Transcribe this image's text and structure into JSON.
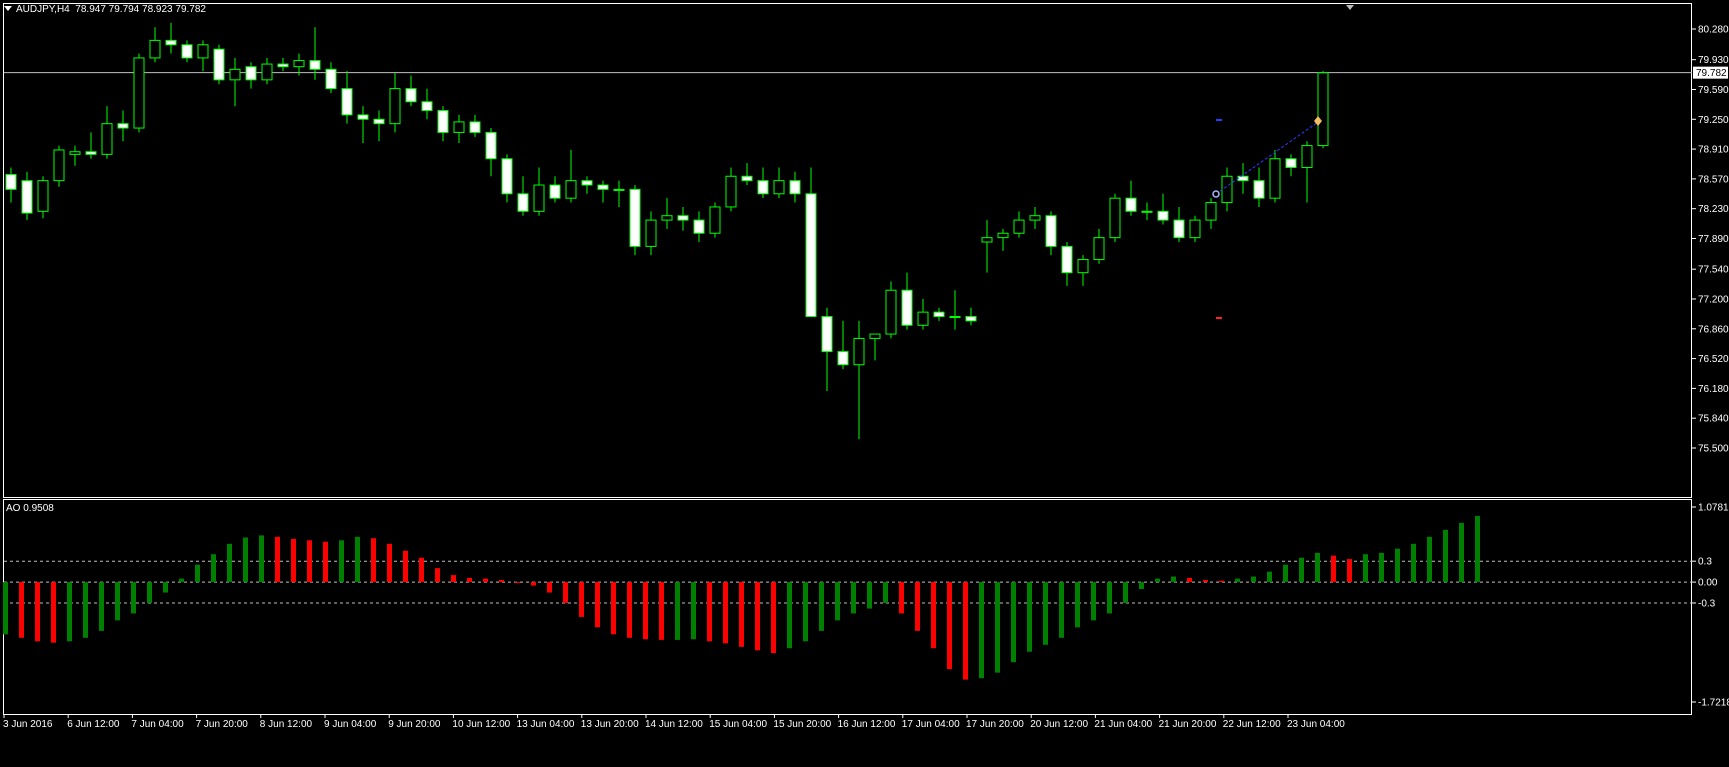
{
  "window": {
    "symbol_label": "AUDJPY,H4",
    "ohlc_label": "78.947 79.794 78.923 79.782"
  },
  "colors": {
    "background": "#000000",
    "grid": "#ffffff",
    "bull_candle_body": "#000000",
    "bull_candle_border": "#00ff00",
    "bear_candle_body": "#ffffff",
    "bear_candle_border": "#00ff00",
    "ao_up": "#008000",
    "ao_down": "#ff0000"
  },
  "price_axis": {
    "ticks": [
      "80.280",
      "79.930",
      "79.590",
      "79.250",
      "78.910",
      "78.570",
      "78.230",
      "77.890",
      "77.540",
      "77.200",
      "76.860",
      "76.520",
      "76.180",
      "75.840",
      "75.500"
    ],
    "current_price_label": "79.782"
  },
  "ao_panel": {
    "title": "AO 0.9508",
    "ticks": [
      "1.0781",
      "0.3",
      "0.00",
      "-0.3",
      "-1.7218"
    ]
  },
  "time_axis": {
    "labels": [
      "3 Jun 2016",
      "6 Jun 12:00",
      "7 Jun 04:00",
      "7 Jun 20:00",
      "8 Jun 12:00",
      "9 Jun 04:00",
      "9 Jun 20:00",
      "10 Jun 12:00",
      "13 Jun 04:00",
      "13 Jun 20:00",
      "14 Jun 12:00",
      "15 Jun 04:00",
      "15 Jun 20:00",
      "16 Jun 12:00",
      "17 Jun 04:00",
      "17 Jun 20:00",
      "20 Jun 12:00",
      "21 Jun 04:00",
      "21 Jun 20:00",
      "22 Jun 12:00",
      "23 Jun 04:00"
    ]
  },
  "chart_data": [
    {
      "type": "candlestick",
      "title": "AUDJPY,H4",
      "ylim": [
        75.5,
        80.28
      ],
      "current_price": 79.782,
      "candles": [
        {
          "o": 78.62,
          "h": 78.7,
          "l": 78.3,
          "c": 78.45
        },
        {
          "o": 78.55,
          "h": 78.65,
          "l": 78.1,
          "c": 78.18
        },
        {
          "o": 78.2,
          "h": 78.6,
          "l": 78.12,
          "c": 78.55
        },
        {
          "o": 78.55,
          "h": 78.95,
          "l": 78.48,
          "c": 78.9
        },
        {
          "o": 78.85,
          "h": 78.95,
          "l": 78.72,
          "c": 78.88
        },
        {
          "o": 78.88,
          "h": 79.1,
          "l": 78.8,
          "c": 78.85
        },
        {
          "o": 78.85,
          "h": 79.4,
          "l": 78.8,
          "c": 79.2
        },
        {
          "o": 79.2,
          "h": 79.35,
          "l": 79.0,
          "c": 79.15
        },
        {
          "o": 79.15,
          "h": 80.0,
          "l": 79.1,
          "c": 79.95
        },
        {
          "o": 79.95,
          "h": 80.3,
          "l": 79.9,
          "c": 80.15
        },
        {
          "o": 80.15,
          "h": 80.35,
          "l": 80.0,
          "c": 80.1
        },
        {
          "o": 80.1,
          "h": 80.15,
          "l": 79.9,
          "c": 79.95
        },
        {
          "o": 79.95,
          "h": 80.15,
          "l": 79.8,
          "c": 80.1
        },
        {
          "o": 80.05,
          "h": 80.1,
          "l": 79.65,
          "c": 79.7
        },
        {
          "o": 79.7,
          "h": 79.95,
          "l": 79.4,
          "c": 79.82
        },
        {
          "o": 79.85,
          "h": 79.9,
          "l": 79.6,
          "c": 79.7
        },
        {
          "o": 79.7,
          "h": 79.95,
          "l": 79.65,
          "c": 79.88
        },
        {
          "o": 79.88,
          "h": 79.95,
          "l": 79.8,
          "c": 79.85
        },
        {
          "o": 79.85,
          "h": 80.0,
          "l": 79.75,
          "c": 79.92
        },
        {
          "o": 79.92,
          "h": 80.3,
          "l": 79.7,
          "c": 79.82
        },
        {
          "o": 79.82,
          "h": 79.9,
          "l": 79.55,
          "c": 79.6
        },
        {
          "o": 79.6,
          "h": 79.8,
          "l": 79.2,
          "c": 79.3
        },
        {
          "o": 79.3,
          "h": 79.4,
          "l": 78.98,
          "c": 79.25
        },
        {
          "o": 79.25,
          "h": 79.35,
          "l": 79.0,
          "c": 79.2
        },
        {
          "o": 79.2,
          "h": 79.78,
          "l": 79.1,
          "c": 79.6
        },
        {
          "o": 79.6,
          "h": 79.75,
          "l": 79.4,
          "c": 79.45
        },
        {
          "o": 79.45,
          "h": 79.6,
          "l": 79.25,
          "c": 79.35
        },
        {
          "o": 79.35,
          "h": 79.4,
          "l": 79.0,
          "c": 79.1
        },
        {
          "o": 79.1,
          "h": 79.3,
          "l": 78.98,
          "c": 79.22
        },
        {
          "o": 79.22,
          "h": 79.3,
          "l": 79.05,
          "c": 79.1
        },
        {
          "o": 79.1,
          "h": 79.15,
          "l": 78.6,
          "c": 78.8
        },
        {
          "o": 78.8,
          "h": 78.85,
          "l": 78.3,
          "c": 78.4
        },
        {
          "o": 78.4,
          "h": 78.6,
          "l": 78.15,
          "c": 78.2
        },
        {
          "o": 78.2,
          "h": 78.7,
          "l": 78.15,
          "c": 78.5
        },
        {
          "o": 78.5,
          "h": 78.6,
          "l": 78.3,
          "c": 78.35
        },
        {
          "o": 78.35,
          "h": 78.9,
          "l": 78.3,
          "c": 78.55
        },
        {
          "o": 78.55,
          "h": 78.6,
          "l": 78.4,
          "c": 78.5
        },
        {
          "o": 78.5,
          "h": 78.55,
          "l": 78.3,
          "c": 78.45
        },
        {
          "o": 78.45,
          "h": 78.55,
          "l": 78.25,
          "c": 78.45
        },
        {
          "o": 78.45,
          "h": 78.5,
          "l": 77.7,
          "c": 77.8
        },
        {
          "o": 77.8,
          "h": 78.2,
          "l": 77.7,
          "c": 78.1
        },
        {
          "o": 78.1,
          "h": 78.35,
          "l": 78.0,
          "c": 78.15
        },
        {
          "o": 78.15,
          "h": 78.25,
          "l": 77.98,
          "c": 78.1
        },
        {
          "o": 78.1,
          "h": 78.2,
          "l": 77.85,
          "c": 77.95
        },
        {
          "o": 77.95,
          "h": 78.3,
          "l": 77.9,
          "c": 78.25
        },
        {
          "o": 78.25,
          "h": 78.7,
          "l": 78.2,
          "c": 78.6
        },
        {
          "o": 78.6,
          "h": 78.75,
          "l": 78.5,
          "c": 78.55
        },
        {
          "o": 78.55,
          "h": 78.7,
          "l": 78.35,
          "c": 78.4
        },
        {
          "o": 78.4,
          "h": 78.7,
          "l": 78.35,
          "c": 78.55
        },
        {
          "o": 78.55,
          "h": 78.65,
          "l": 78.3,
          "c": 78.4
        },
        {
          "o": 78.4,
          "h": 78.7,
          "l": 77.0,
          "c": 77.0
        },
        {
          "o": 77.0,
          "h": 77.1,
          "l": 76.15,
          "c": 76.6
        },
        {
          "o": 76.6,
          "h": 76.95,
          "l": 76.4,
          "c": 76.45
        },
        {
          "o": 76.45,
          "h": 76.95,
          "l": 75.6,
          "c": 76.75
        },
        {
          "o": 76.75,
          "h": 76.8,
          "l": 76.5,
          "c": 76.8
        },
        {
          "o": 76.8,
          "h": 77.4,
          "l": 76.75,
          "c": 77.3
        },
        {
          "o": 77.3,
          "h": 77.5,
          "l": 76.85,
          "c": 76.9
        },
        {
          "o": 76.9,
          "h": 77.2,
          "l": 76.85,
          "c": 77.05
        },
        {
          "o": 77.05,
          "h": 77.1,
          "l": 76.95,
          "c": 77.0
        },
        {
          "o": 77.0,
          "h": 77.3,
          "l": 76.85,
          "c": 77.0
        },
        {
          "o": 77.0,
          "h": 77.1,
          "l": 76.9,
          "c": 76.95
        },
        {
          "o": 77.85,
          "h": 78.1,
          "l": 77.5,
          "c": 77.9
        },
        {
          "o": 77.9,
          "h": 78.0,
          "l": 77.75,
          "c": 77.95
        },
        {
          "o": 77.95,
          "h": 78.2,
          "l": 77.9,
          "c": 78.1
        },
        {
          "o": 78.1,
          "h": 78.25,
          "l": 78.0,
          "c": 78.15
        },
        {
          "o": 78.15,
          "h": 78.2,
          "l": 77.7,
          "c": 77.8
        },
        {
          "o": 77.8,
          "h": 77.85,
          "l": 77.35,
          "c": 77.5
        },
        {
          "o": 77.5,
          "h": 77.7,
          "l": 77.35,
          "c": 77.65
        },
        {
          "o": 77.65,
          "h": 78.0,
          "l": 77.6,
          "c": 77.9
        },
        {
          "o": 77.9,
          "h": 78.4,
          "l": 77.85,
          "c": 78.35
        },
        {
          "o": 78.35,
          "h": 78.55,
          "l": 78.15,
          "c": 78.2
        },
        {
          "o": 78.2,
          "h": 78.3,
          "l": 78.1,
          "c": 78.2
        },
        {
          "o": 78.2,
          "h": 78.4,
          "l": 78.05,
          "c": 78.1
        },
        {
          "o": 78.1,
          "h": 78.25,
          "l": 77.85,
          "c": 77.9
        },
        {
          "o": 77.9,
          "h": 78.15,
          "l": 77.85,
          "c": 78.1
        },
        {
          "o": 78.1,
          "h": 78.35,
          "l": 78.0,
          "c": 78.3
        },
        {
          "o": 78.3,
          "h": 78.7,
          "l": 78.2,
          "c": 78.6
        },
        {
          "o": 78.6,
          "h": 78.75,
          "l": 78.4,
          "c": 78.55
        },
        {
          "o": 78.55,
          "h": 78.7,
          "l": 78.25,
          "c": 78.35
        },
        {
          "o": 78.35,
          "h": 78.9,
          "l": 78.3,
          "c": 78.8
        },
        {
          "o": 78.8,
          "h": 78.85,
          "l": 78.6,
          "c": 78.7
        },
        {
          "o": 78.7,
          "h": 79.0,
          "l": 78.3,
          "c": 78.95
        },
        {
          "o": 78.95,
          "h": 79.8,
          "l": 78.92,
          "c": 79.78
        }
      ]
    },
    {
      "type": "bar",
      "title": "AO 0.9508",
      "ylim": [
        -1.7218,
        1.0781
      ],
      "values": [
        -0.75,
        -0.8,
        -0.85,
        -0.87,
        -0.85,
        -0.8,
        -0.7,
        -0.55,
        -0.45,
        -0.3,
        -0.15,
        0.05,
        0.25,
        0.4,
        0.55,
        0.64,
        0.67,
        0.65,
        0.62,
        0.6,
        0.58,
        0.6,
        0.65,
        0.63,
        0.55,
        0.45,
        0.35,
        0.2,
        0.1,
        0.06,
        0.05,
        0.03,
        0.0,
        -0.05,
        -0.15,
        -0.3,
        -0.5,
        -0.65,
        -0.75,
        -0.8,
        -0.82,
        -0.83,
        -0.83,
        -0.82,
        -0.85,
        -0.88,
        -0.93,
        -0.98,
        -1.02,
        -0.95,
        -0.85,
        -0.7,
        -0.55,
        -0.45,
        -0.38,
        -0.3,
        -0.45,
        -0.7,
        -0.95,
        -1.25,
        -1.4,
        -1.38,
        -1.3,
        -1.15,
        -1.0,
        -0.9,
        -0.8,
        -0.65,
        -0.55,
        -0.45,
        -0.3,
        -0.1,
        0.05,
        0.08,
        0.06,
        0.03,
        0.02,
        0.05,
        0.08,
        0.15,
        0.25,
        0.35,
        0.42,
        0.38,
        0.33,
        0.4,
        0.42,
        0.48,
        0.55,
        0.65,
        0.75,
        0.85,
        0.95
      ]
    }
  ]
}
